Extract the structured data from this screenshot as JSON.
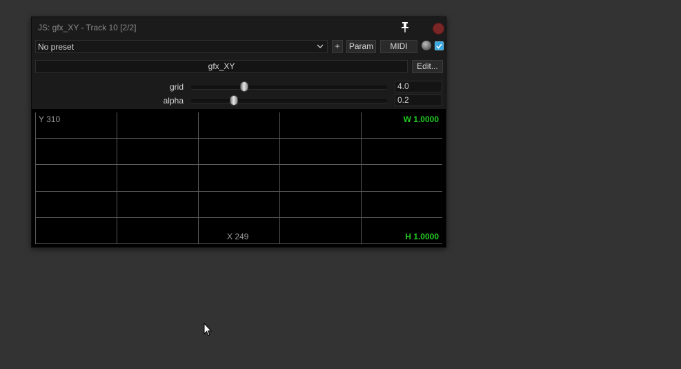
{
  "window": {
    "title": "JS: gfx_XY - Track 10 [2/2]"
  },
  "toolbar": {
    "preset": "No preset",
    "plus_label": "+",
    "param_label": "Param",
    "midi_label": "MIDI",
    "bypass_enabled": true
  },
  "effect": {
    "name": "gfx_XY",
    "edit_label": "Edit..."
  },
  "sliders": [
    {
      "label": "grid",
      "value": "4.0",
      "position": 0.27
    },
    {
      "label": "alpha",
      "value": "0.2",
      "position": 0.22
    }
  ],
  "gfx": {
    "y_readout": "Y 310",
    "x_readout": "X 249",
    "w_readout": "W 1.0000",
    "h_readout": "H 1.0000",
    "readout_color": "#9a9a9a",
    "accent_color": "#22cc22",
    "grid_color": "#5a5a5a",
    "grid_columns": 5,
    "grid_rows": 5
  },
  "icons": {
    "pin": "pin-icon",
    "close": "close-icon",
    "dropdown": "chevron-down-icon",
    "cursor": "mouse-cursor-icon"
  }
}
